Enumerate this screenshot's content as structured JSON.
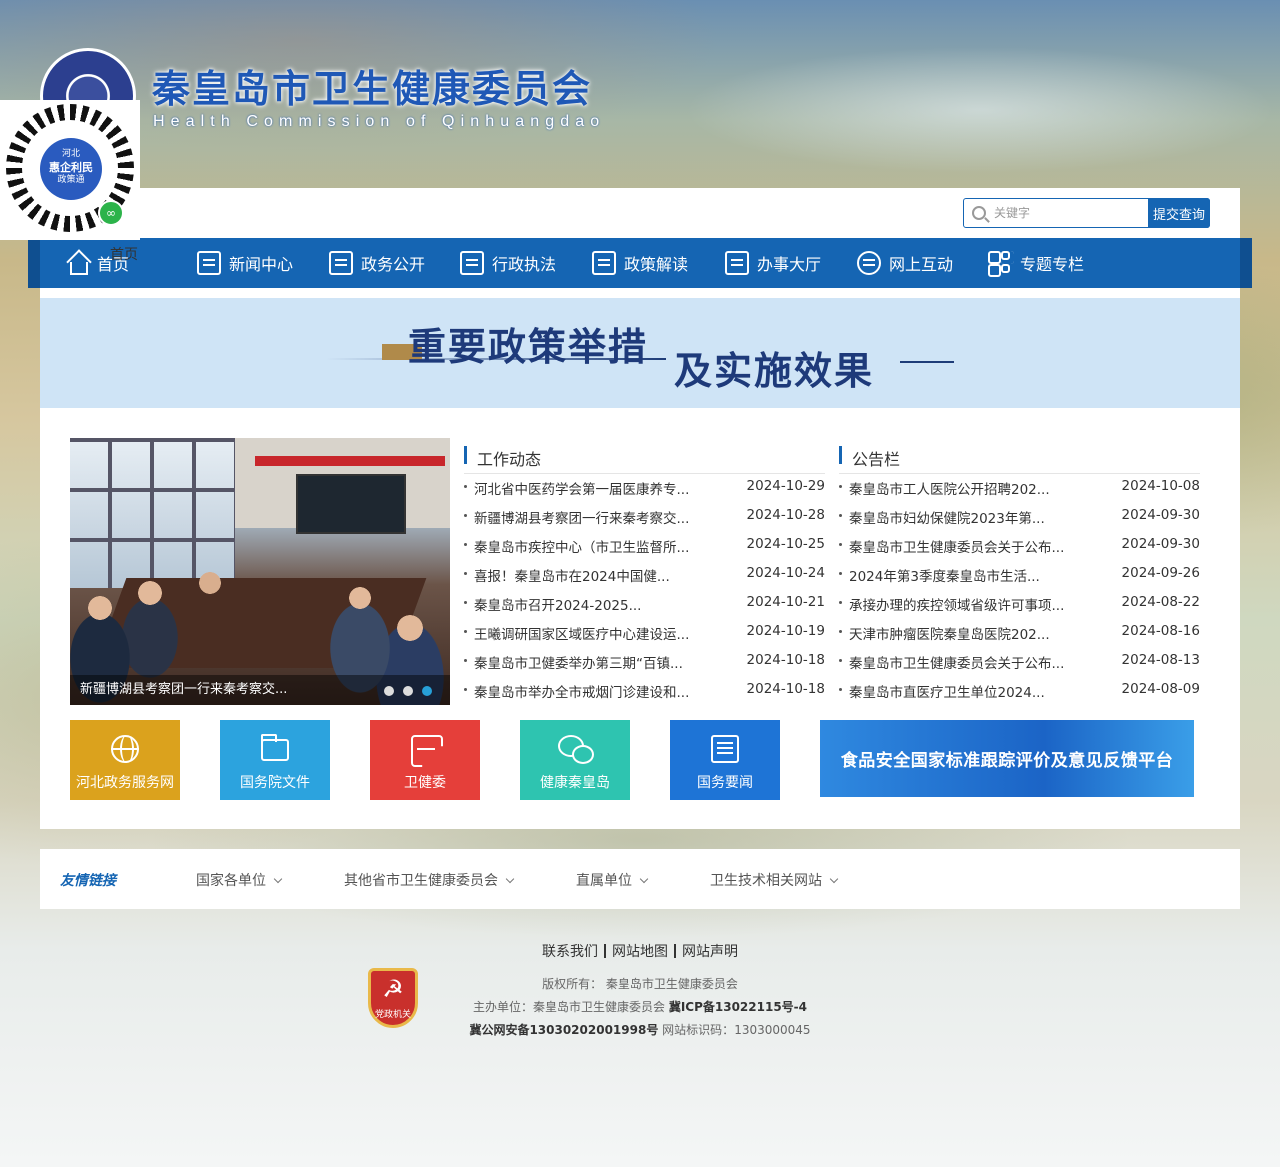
{
  "header": {
    "title": "秦皇岛市卫生健康委员会",
    "subtitle": "Health Commission of Qinhuangdao",
    "qr": {
      "line1": "河北",
      "line2": "惠企利民",
      "line3": "政策通"
    },
    "home_ghost": "首页"
  },
  "search": {
    "placeholder": "关键字",
    "button": "提交查询"
  },
  "nav": [
    {
      "label": "首页",
      "icon": "home-icon"
    },
    {
      "label": "新闻中心",
      "icon": "news-icon"
    },
    {
      "label": "政务公开",
      "icon": "gov-open-icon"
    },
    {
      "label": "行政执法",
      "icon": "law-icon"
    },
    {
      "label": "政策解读",
      "icon": "policy-icon"
    },
    {
      "label": "办事大厅",
      "icon": "service-hall-icon"
    },
    {
      "label": "网上互动",
      "icon": "chat-icon"
    },
    {
      "label": "专题专栏",
      "icon": "grid-icon"
    }
  ],
  "banner": {
    "text1": "重要政策举措",
    "text2": "及实施效果"
  },
  "carousel": {
    "caption": "新疆博湖县考察团一行来秦考察交...",
    "active_slide": 3,
    "slide_count": 3
  },
  "work_news": {
    "heading": "工作动态",
    "items": [
      {
        "title": "河北省中医药学会第一届医康养专...",
        "date": "2024-10-29"
      },
      {
        "title": "新疆博湖县考察团一行来秦考察交...",
        "date": "2024-10-28"
      },
      {
        "title": "秦皇岛市疾控中心（市卫生监督所...",
        "date": "2024-10-25"
      },
      {
        "title": "喜报！秦皇岛市在2024中国健...",
        "date": "2024-10-24"
      },
      {
        "title": "秦皇岛市召开2024-2025...",
        "date": "2024-10-21"
      },
      {
        "title": "王曦调研国家区域医疗中心建设运...",
        "date": "2024-10-19"
      },
      {
        "title": "秦皇岛市卫健委举办第三期“百镇...",
        "date": "2024-10-18"
      },
      {
        "title": "秦皇岛市举办全市戒烟门诊建设和...",
        "date": "2024-10-18"
      }
    ]
  },
  "notices": {
    "heading": "公告栏",
    "items": [
      {
        "title": "秦皇岛市工人医院公开招聘202...",
        "date": "2024-10-08"
      },
      {
        "title": "秦皇岛市妇幼保健院2023年第...",
        "date": "2024-09-30"
      },
      {
        "title": "秦皇岛市卫生健康委员会关于公布...",
        "date": "2024-09-30"
      },
      {
        "title": "2024年第3季度秦皇岛市生活...",
        "date": "2024-09-26"
      },
      {
        "title": "承接办理的疾控领域省级许可事项...",
        "date": "2024-08-22"
      },
      {
        "title": "天津市肿瘤医院秦皇岛医院202...",
        "date": "2024-08-16"
      },
      {
        "title": "秦皇岛市卫生健康委员会关于公布...",
        "date": "2024-08-13"
      },
      {
        "title": "秦皇岛市直医疗卫生单位2024...",
        "date": "2024-08-09"
      }
    ]
  },
  "quick_links": [
    {
      "label": "河北政务服务网",
      "color": "#dba21d",
      "icon": "globe-icon"
    },
    {
      "label": "国务院文件",
      "color": "#2ca3de",
      "icon": "folder-icon"
    },
    {
      "label": "卫健委",
      "color": "#e53f3a",
      "icon": "scan-icon"
    },
    {
      "label": "健康秦皇岛",
      "color": "#2ec4b0",
      "icon": "wechat-icon"
    },
    {
      "label": "国务要闻",
      "color": "#1e74d6",
      "icon": "document-icon"
    }
  ],
  "food_banner": "食品安全国家标准跟踪评价及意见反馈平台",
  "friend_links": {
    "title": "友情链接",
    "dropdowns": [
      "国家各单位",
      "其他省市卫生健康委员会",
      "直属单位",
      "卫生技术相关网站"
    ]
  },
  "footer": {
    "links": [
      "联系我们",
      "网站地图",
      "网站声明"
    ],
    "copyright": "版权所有：  秦皇岛市卫生健康委员会",
    "sponsor": "主办单位：秦皇岛市卫生健康委员会",
    "icp": "冀ICP备13022115号-4",
    "police": "冀公网安备13030202001998号",
    "site_id_label": "网站标识码：",
    "site_id": "1303000045",
    "badge_text": "党政机关"
  },
  "colors": {
    "primary": "#1565b3",
    "banner_bg": "#cfe4f6",
    "banner_text": "#1e3a7a"
  }
}
